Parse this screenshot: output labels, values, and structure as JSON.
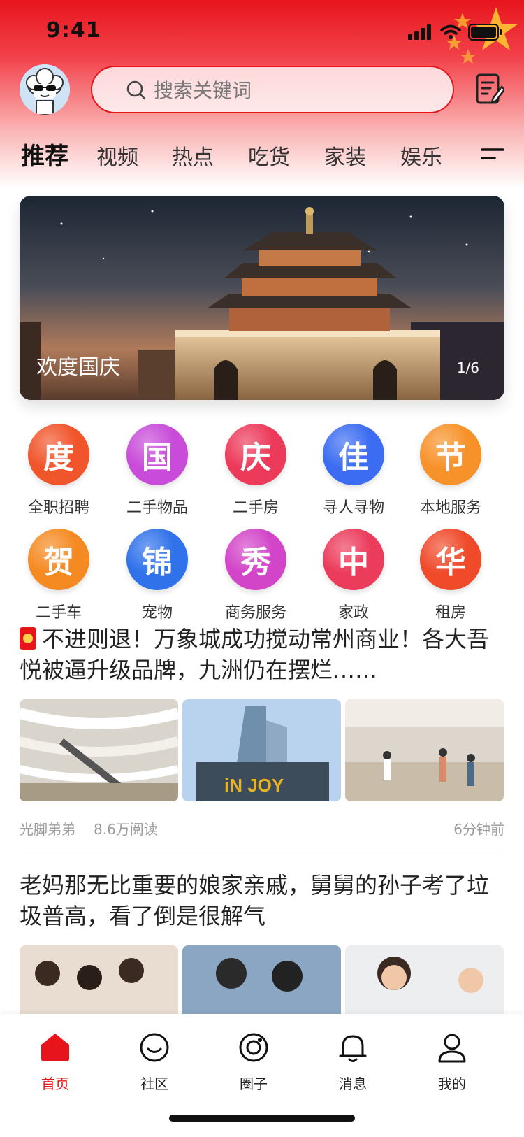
{
  "status_bar": {
    "time": "9:41"
  },
  "search": {
    "placeholder": "搜索关键词"
  },
  "tabs": [
    {
      "label": "推荐",
      "active": true
    },
    {
      "label": "视频"
    },
    {
      "label": "热点"
    },
    {
      "label": "吃货"
    },
    {
      "label": "家装"
    },
    {
      "label": "娱乐"
    }
  ],
  "banner": {
    "caption": "欢度国庆",
    "counter": "1/6"
  },
  "grid": [
    {
      "glyph": "度",
      "label": "全职招聘",
      "color": "#f0552b"
    },
    {
      "glyph": "国",
      "label": "二手物品",
      "color": "#c84bd9"
    },
    {
      "glyph": "庆",
      "label": "二手房",
      "color": "#ec3a5a"
    },
    {
      "glyph": "佳",
      "label": "寻人寻物",
      "color": "#3b6cf2"
    },
    {
      "glyph": "节",
      "label": "本地服务",
      "color": "#f7922a"
    },
    {
      "glyph": "贺",
      "label": "二手车",
      "color": "#f58a22"
    },
    {
      "glyph": "锦",
      "label": "宠物",
      "color": "#2f72ea"
    },
    {
      "glyph": "秀",
      "label": "商务服务",
      "color": "#d244c8"
    },
    {
      "glyph": "中",
      "label": "家政",
      "color": "#ec3c5c"
    },
    {
      "glyph": "华",
      "label": "租房",
      "color": "#ef4a2a"
    }
  ],
  "articles": [
    {
      "title": "不进则退！万象城成功搅动常州商业！各大吾悦被逼升级品牌，九洲仍在摆烂……",
      "author": "光脚弟弟",
      "reads": "8.6万阅读",
      "time": "6分钟前"
    },
    {
      "title": "老妈那无比重要的娘家亲戚，舅舅的孙子考了垃圾普高，看了倒是很解气"
    }
  ],
  "bottom_nav": [
    {
      "label": "首页",
      "icon": "home-icon",
      "active": true
    },
    {
      "label": "社区",
      "icon": "smile-icon"
    },
    {
      "label": "圈子",
      "icon": "circle-icon"
    },
    {
      "label": "消息",
      "icon": "bell-icon"
    },
    {
      "label": "我的",
      "icon": "user-icon"
    }
  ],
  "colors": {
    "brand": "#e8141c"
  }
}
